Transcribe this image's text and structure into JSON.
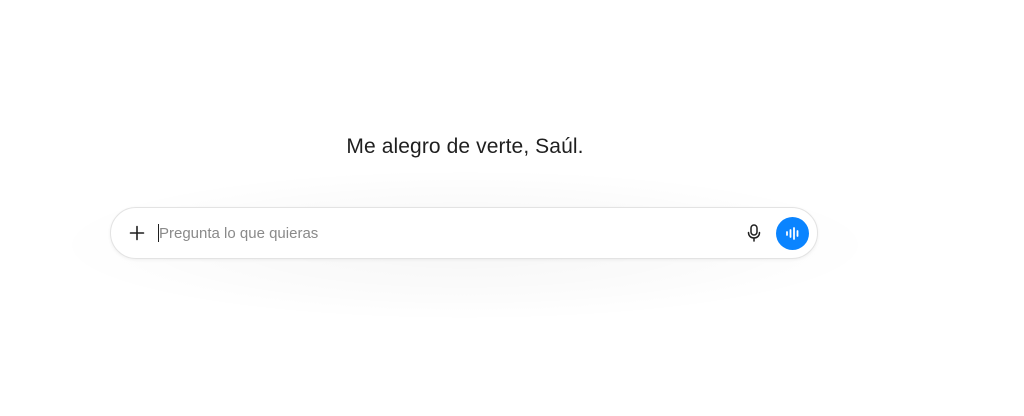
{
  "greeting": {
    "text": "Me alegro de verte, Saúl."
  },
  "composer": {
    "placeholder": "Pregunta lo que quieras",
    "value": "",
    "icons": {
      "attach": "plus-icon",
      "dictate": "microphone-icon",
      "voice_mode": "voice-wave-icon"
    }
  },
  "colors": {
    "background": "#ffffff",
    "text": "#1f1f1f",
    "placeholder": "#8a8a8a",
    "accent": "#0a84ff",
    "border": "#e3e3e3"
  }
}
